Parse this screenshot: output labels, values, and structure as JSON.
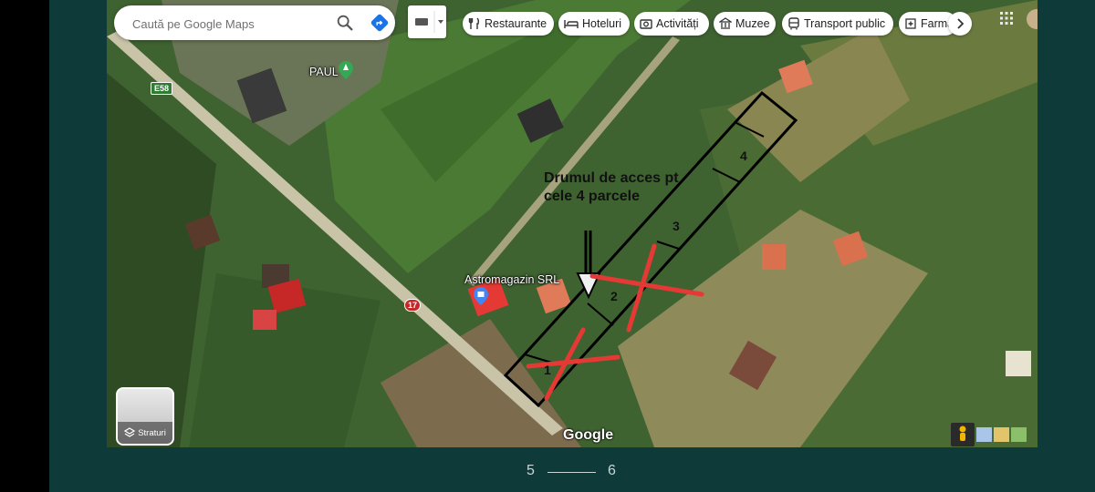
{
  "search": {
    "placeholder": "Caută pe Google Maps"
  },
  "chips": [
    {
      "label": "Restaurante",
      "icon": "fork-knife-icon"
    },
    {
      "label": "Hoteluri",
      "icon": "bed-icon"
    },
    {
      "label": "Activități",
      "icon": "camera-icon"
    },
    {
      "label": "Muzee",
      "icon": "museum-icon"
    },
    {
      "label": "Transport public",
      "icon": "bus-icon"
    },
    {
      "label": "Farma",
      "icon": "pharmacy-icon"
    }
  ],
  "layers_button": {
    "label": "Straturi"
  },
  "map_labels": {
    "poi_paul": "PAUL",
    "poi_astromagazin": "Astromagazin SRL",
    "road_e58": "E58",
    "road_17": "17",
    "google_logo": "Google"
  },
  "annotation": {
    "text": "Drumul de acces pt cele 4 parcele",
    "parcels": [
      "1",
      "2",
      "3",
      "4"
    ],
    "crossed_out": [
      "1",
      "2"
    ]
  },
  "pager": {
    "current": "5",
    "next": "6"
  },
  "colors": {
    "background": "#0f3a3a",
    "annotation_cross": "#e53935",
    "poi_green": "#34a853",
    "poi_blue": "#4285f4"
  }
}
